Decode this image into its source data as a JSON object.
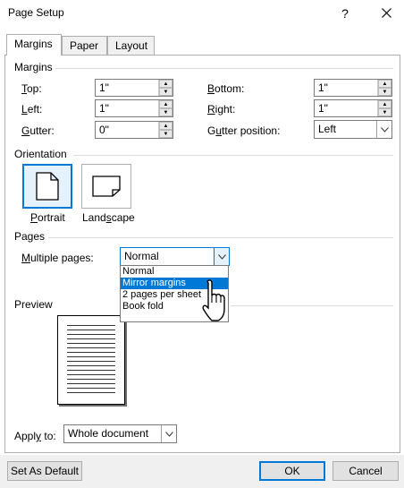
{
  "window": {
    "title": "Page Setup",
    "help_label": "?",
    "close_label": "✕"
  },
  "tabs": [
    {
      "label": "Margins",
      "active": true
    },
    {
      "label": "Paper",
      "active": false
    },
    {
      "label": "Layout",
      "active": false
    }
  ],
  "margins": {
    "section_label": "Margins",
    "top": {
      "label_u": "T",
      "label_rest": "op:",
      "value": "1\""
    },
    "bottom": {
      "label_u": "B",
      "label_rest": "ottom:",
      "value": "1\""
    },
    "left": {
      "label_u": "L",
      "label_rest": "eft:",
      "value": "1\""
    },
    "right": {
      "label_u": "R",
      "label_rest": "ight:",
      "value": "1\""
    },
    "gutter": {
      "label_u": "G",
      "label_rest": "utter:",
      "value": "0\""
    },
    "gutter_position": {
      "label_pre": "G",
      "label_u": "u",
      "label_rest": "tter position:",
      "value": "Left"
    }
  },
  "orientation": {
    "section_label": "Orientation",
    "portrait": {
      "label_u": "P",
      "label_rest": "ortrait",
      "selected": true
    },
    "landscape": {
      "label_pre": "Land",
      "label_u": "s",
      "label_rest": "cape",
      "selected": false
    }
  },
  "pages": {
    "section_label": "Pages",
    "multiple_label_u": "M",
    "multiple_label_rest": "ultiple pages:",
    "selected_value": "Normal",
    "options": [
      {
        "label": "Normal",
        "highlighted": false
      },
      {
        "label": "Mirror margins",
        "highlighted": true
      },
      {
        "label": "2 pages per sheet",
        "highlighted": false
      },
      {
        "label": "Book fold",
        "highlighted": false
      }
    ]
  },
  "preview": {
    "section_label": "Preview"
  },
  "apply": {
    "label_pre": "Appl",
    "label_u": "y",
    "label_rest": " to:",
    "value": "Whole document"
  },
  "buttons": {
    "set_default": "Set As Default",
    "ok": "OK",
    "cancel": "Cancel"
  },
  "colors": {
    "accent": "#0078d7",
    "highlight_bg": "#0078d7",
    "dialog_bg": "#f0f0f0"
  }
}
